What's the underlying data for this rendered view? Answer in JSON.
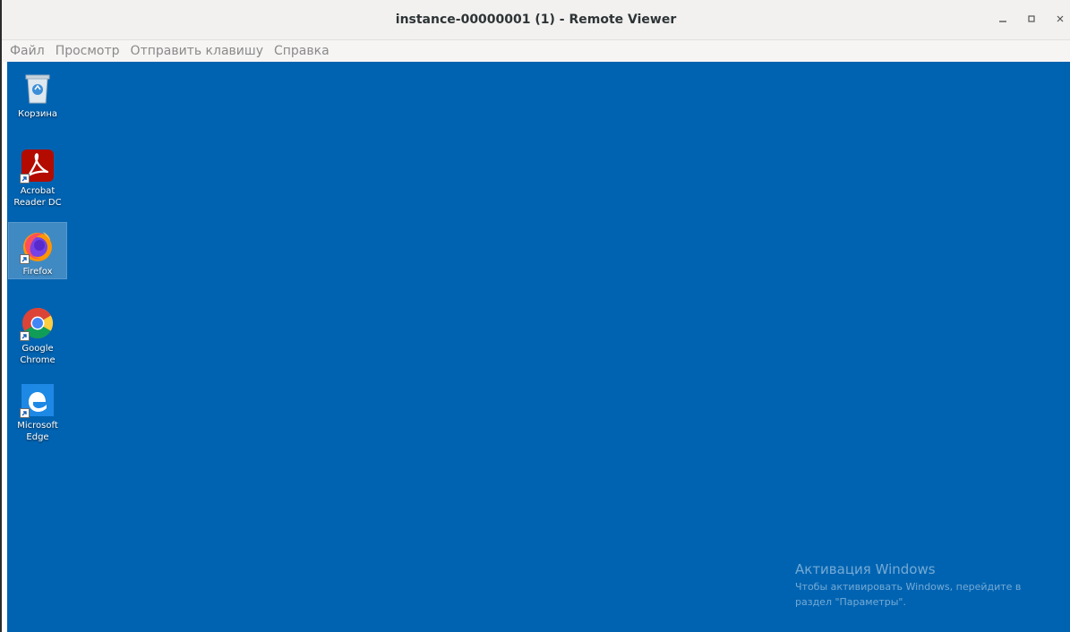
{
  "window": {
    "title": "instance-00000001 (1) - Remote Viewer",
    "controls": [
      "minimize",
      "maximize",
      "close"
    ]
  },
  "menu": {
    "items": [
      "Файл",
      "Просмотр",
      "Отправить клавишу",
      "Справка"
    ]
  },
  "desktop": {
    "background_color": "#0063b1",
    "icons": [
      {
        "label": "Корзина",
        "icon": "recycle-bin-icon",
        "shortcut": false,
        "selected": false
      },
      {
        "label": "Acrobat Reader DC",
        "icon": "acrobat-icon",
        "shortcut": true,
        "selected": false
      },
      {
        "label": "Firefox",
        "icon": "firefox-icon",
        "shortcut": true,
        "selected": true
      },
      {
        "label": "Google Chrome",
        "icon": "chrome-icon",
        "shortcut": true,
        "selected": false
      },
      {
        "label": "Microsoft Edge",
        "icon": "edge-icon",
        "shortcut": true,
        "selected": false
      }
    ]
  },
  "watermark": {
    "title": "Активация Windows",
    "line1": "Чтобы активировать Windows, перейдите в",
    "line2": "раздел \"Параметры\"."
  }
}
